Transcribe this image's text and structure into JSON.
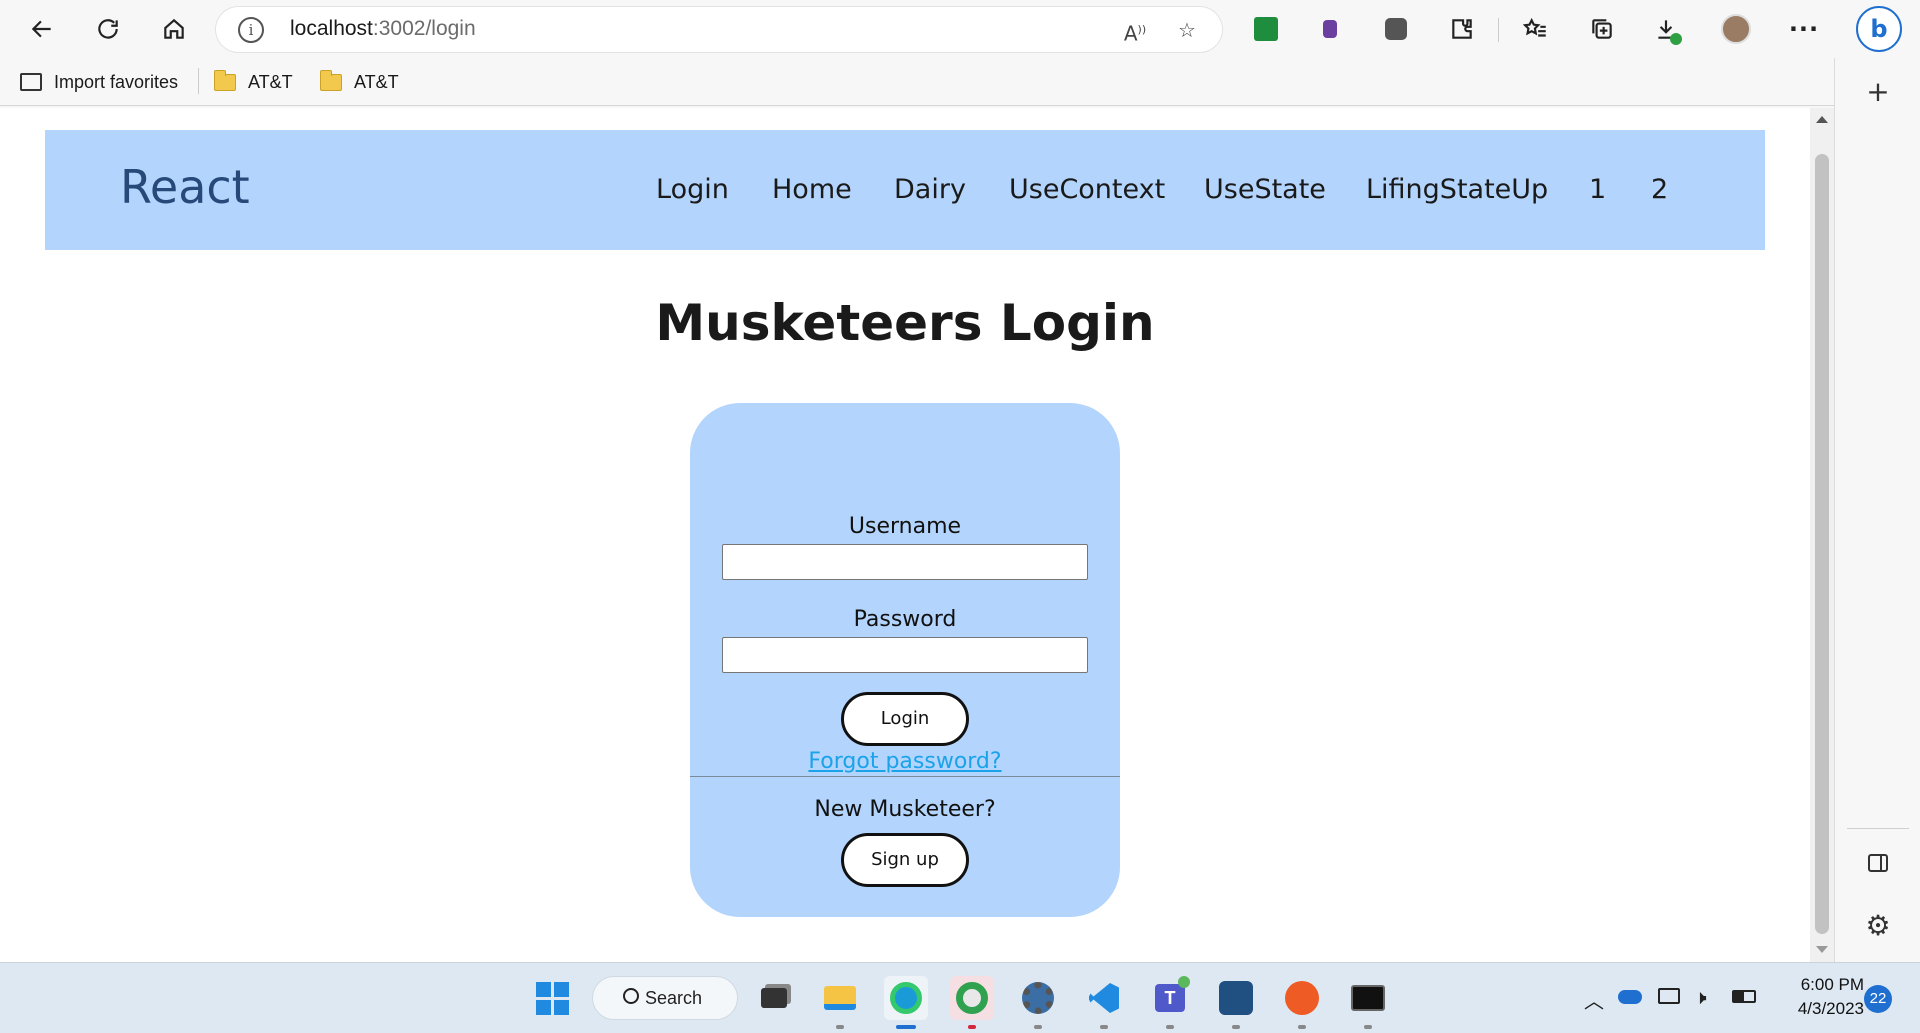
{
  "browser": {
    "url_host": "localhost",
    "url_path": ":3002/login",
    "bookmarks": [
      "Import favorites",
      "AT&T",
      "AT&T"
    ]
  },
  "navbar": {
    "brand": "React",
    "links": [
      "Login",
      "Home",
      "Dairy",
      "UseContext",
      "UseState",
      "LifingStateUp",
      "1",
      "2"
    ]
  },
  "page": {
    "title": "Musketeers Login"
  },
  "form": {
    "username_label": "Username",
    "username_value": "",
    "password_label": "Password",
    "password_value": "",
    "login_button": "Login",
    "forgot_link": "Forgot password?",
    "new_user_text": "New Musketeer?",
    "signup_button": "Sign up"
  },
  "taskbar": {
    "search_label": "Search",
    "time": "6:00 PM",
    "date": "4/3/2023",
    "notification_count": "22"
  },
  "colors": {
    "navbar_bg": "#b3d4fc",
    "brand_text": "#27497a",
    "link": "#1aa3e8"
  }
}
